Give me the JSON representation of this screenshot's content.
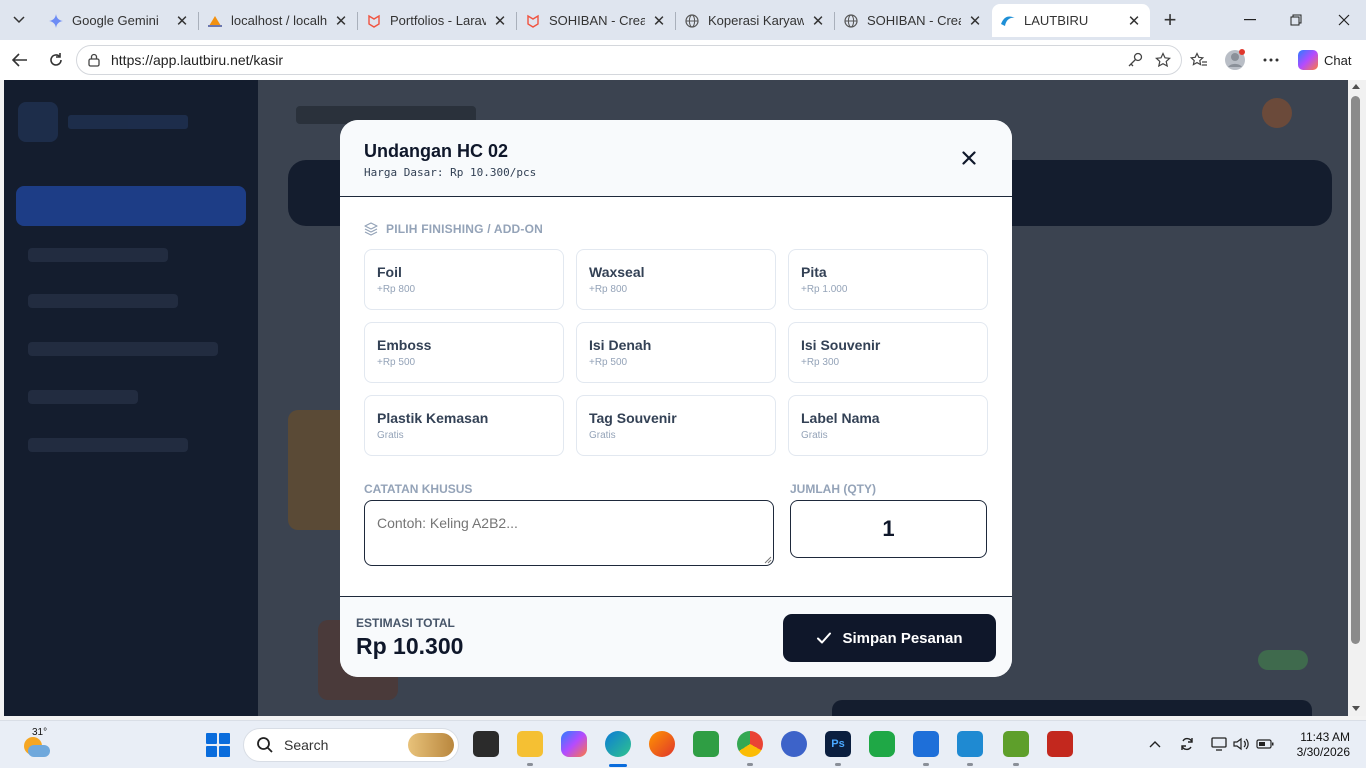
{
  "browser": {
    "tabs": [
      {
        "title": "Google Gemini",
        "icon": "gemini-icon",
        "active": false
      },
      {
        "title": "localhost / localhos",
        "icon": "phpmyadmin-icon",
        "active": false
      },
      {
        "title": "Portfolios - Laravel",
        "icon": "laravel-icon",
        "active": false
      },
      {
        "title": "SOHIBAN - Creativ",
        "icon": "laravel-icon",
        "active": false
      },
      {
        "title": "Koperasi Karyawan",
        "icon": "globe-icon",
        "active": false
      },
      {
        "title": "SOHIBAN - Creativ",
        "icon": "globe-icon",
        "active": false
      },
      {
        "title": "LAUTBIRU",
        "icon": "lautbiru-icon",
        "active": true
      }
    ],
    "url": "https://app.lautbiru.net/kasir",
    "chat_label": "Chat"
  },
  "modal": {
    "title": "Undangan HC 02",
    "subtitle": "Harga Dasar: Rp 10.300/pcs",
    "section_label": "PILIH FINISHING / ADD-ON",
    "options": [
      {
        "name": "Foil",
        "price": "+Rp 800"
      },
      {
        "name": "Waxseal",
        "price": "+Rp 800"
      },
      {
        "name": "Pita",
        "price": "+Rp 1.000"
      },
      {
        "name": "Emboss",
        "price": "+Rp 500"
      },
      {
        "name": "Isi Denah",
        "price": "+Rp 500"
      },
      {
        "name": "Isi Souvenir",
        "price": "+Rp 300"
      },
      {
        "name": "Plastik Kemasan",
        "price": "Gratis"
      },
      {
        "name": "Tag Souvenir",
        "price": "Gratis"
      },
      {
        "name": "Label Nama",
        "price": "Gratis"
      }
    ],
    "notes_label": "CATATAN KHUSUS",
    "notes_placeholder": "Contoh: Keling A2B2...",
    "qty_label": "JUMLAH (QTY)",
    "qty_value": "1",
    "estimate_label": "ESTIMASI TOTAL",
    "estimate_value": "Rp 10.300",
    "save_label": "Simpan Pesanan"
  },
  "taskbar": {
    "weather_temp": "31°",
    "search_label": "Search",
    "time": "11:43 AM",
    "date": "3/30/2026"
  },
  "colors": {
    "primary_dark": "#0f172a",
    "muted_text": "#94a3b8",
    "border": "#e2e8f0"
  }
}
